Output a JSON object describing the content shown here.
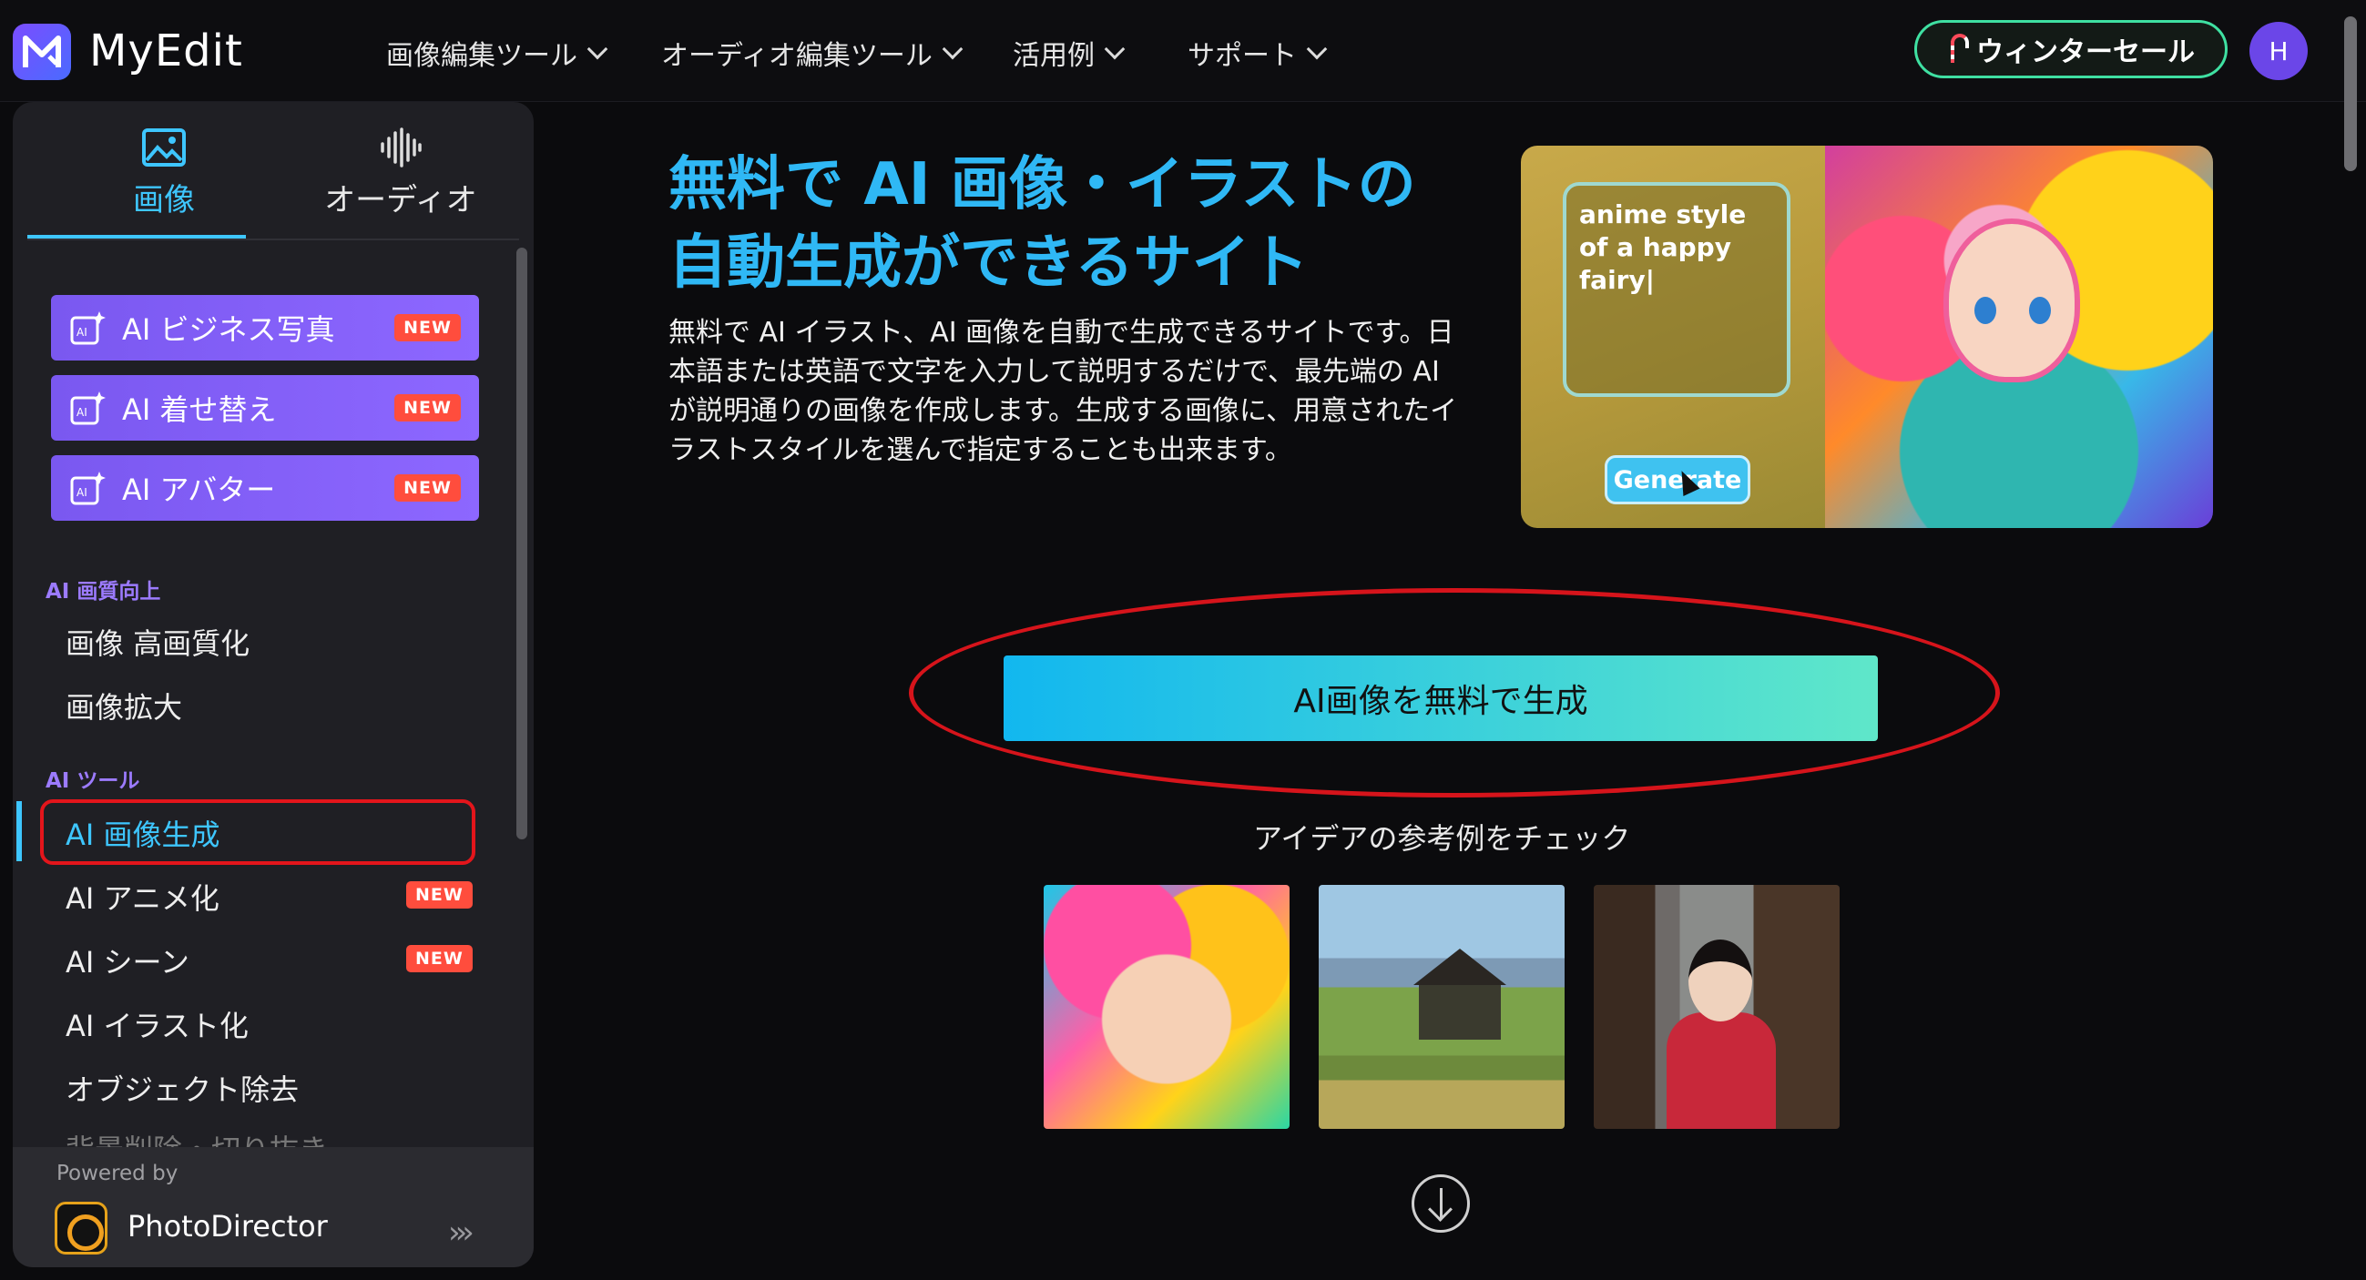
{
  "header": {
    "logo_text": "MyEdit",
    "nav": [
      {
        "label": "画像編集ツール"
      },
      {
        "label": "オーディオ編集ツール"
      },
      {
        "label": "活用例"
      },
      {
        "label": "サポート"
      }
    ],
    "sale_label": "ウィンターセール",
    "avatar_initial": "H"
  },
  "sidebar": {
    "tabs": [
      {
        "label": "画像",
        "icon": "image-icon",
        "active": true
      },
      {
        "label": "オーディオ",
        "icon": "waveform-icon",
        "active": false
      }
    ],
    "promo_items": [
      {
        "label": "AI ビジネス写真",
        "badge": "NEW"
      },
      {
        "label": "AI 着せ替え",
        "badge": "NEW"
      },
      {
        "label": "AI アバター",
        "badge": "NEW"
      }
    ],
    "sections": [
      {
        "title": "AI 画質向上",
        "items": [
          {
            "label": "画像 高画質化"
          },
          {
            "label": "画像拡大"
          }
        ]
      },
      {
        "title": "AI ツール",
        "items": [
          {
            "label": "AI 画像生成",
            "active": true
          },
          {
            "label": "AI アニメ化",
            "badge": "NEW"
          },
          {
            "label": "AI シーン",
            "badge": "NEW"
          },
          {
            "label": "AI イラスト化"
          },
          {
            "label": "オブジェクト除去"
          },
          {
            "label": "背景削除・切り抜き"
          }
        ]
      }
    ],
    "powered_by": "Powered by",
    "powered_product": "PhotoDirector"
  },
  "main": {
    "hero_title": "無料で AI 画像・イラストの自動生成ができるサイト",
    "hero_description": "無料で AI イラスト、AI 画像を自動で生成できるサイトです。日本語または英語で文字を入力して説明するだけで、最先端の AI が説明通りの画像を作成します。生成する画像に、用意されたイラストスタイルを選んで指定することも出来ます。",
    "hero_image": {
      "prompt_text": "anime style of a happy fairy|",
      "button_label": "Generate"
    },
    "cta_label": "AI画像を無料で生成",
    "ideas_title": "アイデアの参考例をチェック"
  },
  "colors": {
    "accent_blue": "#2fb8f5",
    "promo_purple": "#7a58f0",
    "badge_red": "#ff4d3d",
    "highlight_red": "#d6141b",
    "sale_green": "#3fe0a2"
  }
}
